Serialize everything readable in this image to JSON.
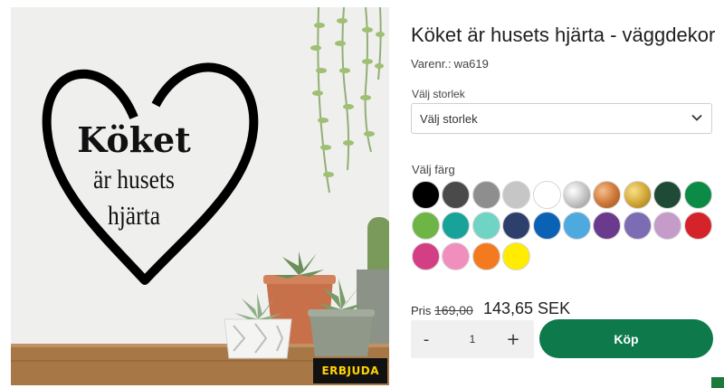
{
  "product": {
    "title": "Köket är husets hjärta - väggdekor",
    "sku_label": "Varenr.:",
    "sku_value": "wa619"
  },
  "image": {
    "decal_lines": [
      "Köket",
      "är husets",
      "hjärta"
    ],
    "badge": "ERBJUDA"
  },
  "size": {
    "label": "Välj storlek",
    "selected": "Välj storlek"
  },
  "color": {
    "label": "Välj färg",
    "swatches": [
      "#000000",
      "#4a4a4a",
      "#8e8e8e",
      "#c6c6c6",
      "#ffffff",
      "silver-metallic",
      "copper-metallic",
      "gold-metallic",
      "#1e4a36",
      "#0b8b45",
      "#6db544",
      "#18a39a",
      "#6fd4c4",
      "#2d3f6b",
      "#0b61b3",
      "#4ea9df",
      "#6a3a8e",
      "#7c6cb3",
      "#c59bc9",
      "#d5232a",
      "#d43e84",
      "#f08fbe",
      "#f47a20",
      "#ffec00"
    ]
  },
  "price": {
    "label": "Pris",
    "old": "169,00",
    "new": "143,65 SEK"
  },
  "quantity": {
    "minus": "-",
    "value": "1",
    "plus": "+"
  },
  "buy_label": "Köp",
  "colors": {
    "accent": "#0e7a4c",
    "badge_text": "#ffd400"
  }
}
